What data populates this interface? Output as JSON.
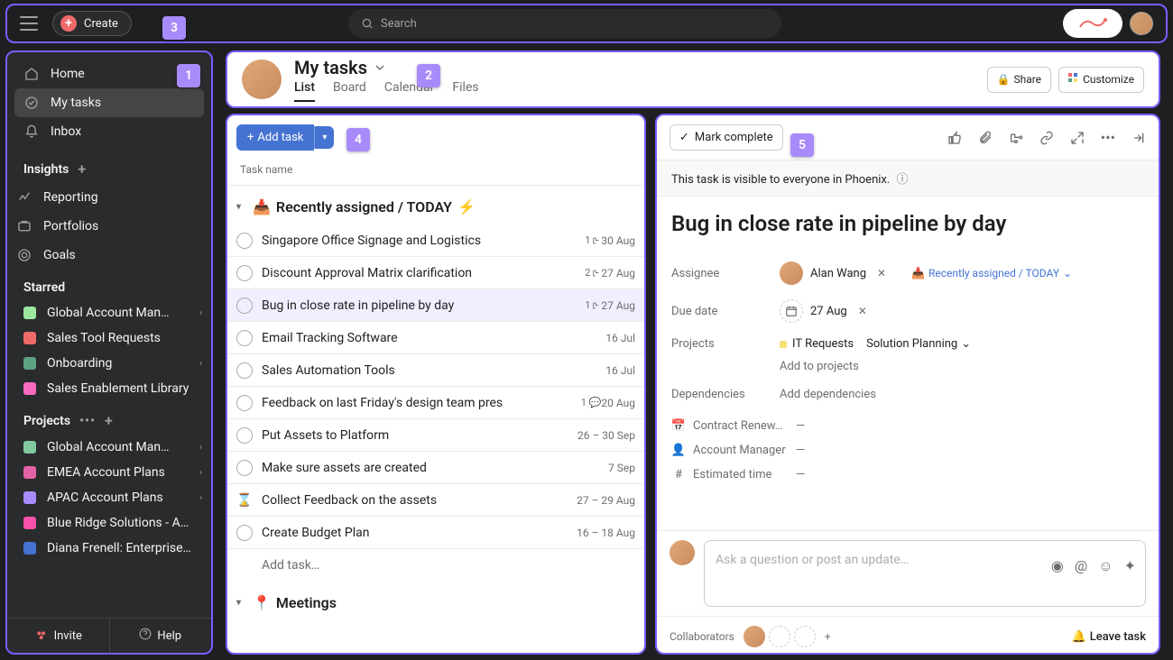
{
  "topbar": {
    "create": "Create",
    "search_placeholder": "Search"
  },
  "tour": {
    "b1": "1",
    "b2": "2",
    "b3": "3",
    "b4": "4",
    "b5": "5"
  },
  "sidebar": {
    "nav": {
      "home": "Home",
      "my_tasks": "My tasks",
      "inbox": "Inbox"
    },
    "insights": {
      "header": "Insights",
      "reporting": "Reporting",
      "portfolios": "Portfolios",
      "goals": "Goals"
    },
    "starred": {
      "header": "Starred",
      "items": [
        {
          "label": "Global Account Man…",
          "color": "proj-green",
          "caret": true
        },
        {
          "label": "Sales Tool Requests",
          "color": "proj-red",
          "caret": false
        },
        {
          "label": "Onboarding",
          "color": "proj-teal",
          "caret": true
        },
        {
          "label": "Sales Enablement Library",
          "color": "proj-pink",
          "caret": false
        }
      ]
    },
    "projects": {
      "header": "Projects",
      "items": [
        {
          "label": "Global Account Man…",
          "color": "proj-lgreen",
          "caret": true
        },
        {
          "label": "EMEA Account Plans",
          "color": "proj-dkpink",
          "caret": true
        },
        {
          "label": "APAC Account Plans",
          "color": "proj-purple",
          "caret": true
        },
        {
          "label": "Blue Ridge Solutions - A…",
          "color": "proj-hotpink",
          "caret": false
        },
        {
          "label": "Diana Frenell: Enterprise…",
          "color": "proj-blue",
          "caret": false
        }
      ]
    },
    "footer": {
      "invite": "Invite",
      "help": "Help"
    }
  },
  "header": {
    "title": "My tasks",
    "tabs": {
      "list": "List",
      "board": "Board",
      "calendar": "Calendar",
      "files": "Files"
    },
    "share": "Share",
    "customize": "Customize"
  },
  "tasklist": {
    "add_task": "Add task",
    "col": "Task name",
    "sections": [
      {
        "title": "Recently assigned / TODAY",
        "emoji_pre": "📥",
        "emoji_post": "⚡",
        "tasks": [
          {
            "name": "Singapore Office Signage and Logistics",
            "sub": "1",
            "date": "30 Aug"
          },
          {
            "name": "Discount Approval Matrix clarification",
            "sub": "2",
            "date": "27 Aug"
          },
          {
            "name": "Bug in close rate in pipeline by day",
            "sub": "1",
            "date": "27 Aug",
            "selected": true
          },
          {
            "name": "Email Tracking Software",
            "date": "16 Jul"
          },
          {
            "name": "Sales Automation Tools",
            "date": "16 Jul"
          },
          {
            "name": "Feedback on last Friday's design team pres",
            "comment": "1",
            "date": "20 Aug"
          },
          {
            "name": "Put Assets to Platform",
            "date": "26 – 30 Sep"
          },
          {
            "name": "Make sure assets are created",
            "date": "7 Sep"
          },
          {
            "name": "Collect Feedback on the assets",
            "date": "27 – 29 Aug",
            "hourglass": true
          },
          {
            "name": "Create Budget Plan",
            "date": "16 – 18 Aug"
          }
        ],
        "add_inline": "Add task…"
      },
      {
        "title": "Meetings",
        "emoji_pre": "📍",
        "tasks": []
      }
    ]
  },
  "detail": {
    "mark_complete": "Mark complete",
    "visibility": "This task is visible to everyone in Phoenix.",
    "title": "Bug in close rate in pipeline by day",
    "labels": {
      "assignee": "Assignee",
      "due_date": "Due date",
      "projects": "Projects",
      "dependencies": "Dependencies"
    },
    "assignee_name": "Alan Wang",
    "section_chip": "Recently assigned / TODAY",
    "due_date": "27 Aug",
    "project1": "IT Requests",
    "project2": "Solution Planning",
    "add_projects": "Add to projects",
    "add_deps": "Add dependencies",
    "custom_fields": [
      {
        "icon": "📅",
        "label": "Contract Renew…",
        "value": "—"
      },
      {
        "icon": "👤",
        "label": "Account Manager",
        "value": "—"
      },
      {
        "icon": "#",
        "label": "Estimated time",
        "value": "—"
      }
    ],
    "comment_placeholder": "Ask a question or post an update…",
    "collaborators": "Collaborators",
    "leave": "Leave task"
  }
}
